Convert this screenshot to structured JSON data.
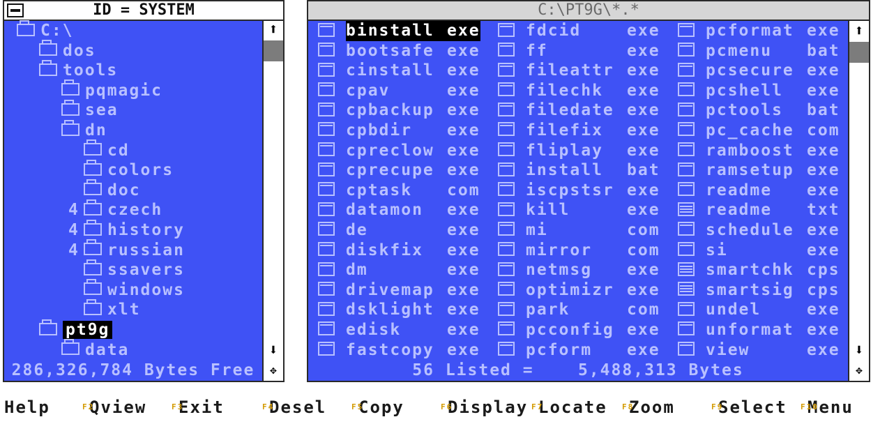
{
  "tree_window": {
    "title": "ID = SYSTEM",
    "footer": "286,326,784 Bytes Free",
    "nodes": [
      {
        "label": "C:\\",
        "depth": 0,
        "prefix": ""
      },
      {
        "label": "dos",
        "depth": 1,
        "prefix": ""
      },
      {
        "label": "tools",
        "depth": 1,
        "prefix": ""
      },
      {
        "label": "pqmagic",
        "depth": 2,
        "prefix": ""
      },
      {
        "label": "sea",
        "depth": 2,
        "prefix": ""
      },
      {
        "label": "dn",
        "depth": 2,
        "prefix": ""
      },
      {
        "label": "cd",
        "depth": 3,
        "prefix": ""
      },
      {
        "label": "colors",
        "depth": 3,
        "prefix": ""
      },
      {
        "label": "doc",
        "depth": 3,
        "prefix": ""
      },
      {
        "label": "czech",
        "depth": 3,
        "prefix": "4"
      },
      {
        "label": "history",
        "depth": 3,
        "prefix": "4"
      },
      {
        "label": "russian",
        "depth": 3,
        "prefix": "4"
      },
      {
        "label": "ssavers",
        "depth": 3,
        "prefix": ""
      },
      {
        "label": "windows",
        "depth": 3,
        "prefix": ""
      },
      {
        "label": "xlt",
        "depth": 3,
        "prefix": ""
      },
      {
        "label": "pt9g",
        "depth": 1,
        "prefix": "",
        "selected": true
      },
      {
        "label": "data",
        "depth": 2,
        "prefix": ""
      }
    ]
  },
  "files_window": {
    "title": "C:\\PT9G\\*.*",
    "footer": "56 Listed =    5,488,313 Bytes",
    "columns": [
      [
        {
          "name": "binstall",
          "ext": "exe",
          "highlight": true
        },
        {
          "name": "bootsafe",
          "ext": "exe"
        },
        {
          "name": "cinstall",
          "ext": "exe"
        },
        {
          "name": "cpav",
          "ext": "exe"
        },
        {
          "name": "cpbackup",
          "ext": "exe"
        },
        {
          "name": "cpbdir",
          "ext": "exe"
        },
        {
          "name": "cpreclow",
          "ext": "exe"
        },
        {
          "name": "cprecupe",
          "ext": "exe"
        },
        {
          "name": "cptask",
          "ext": "com"
        },
        {
          "name": "datamon",
          "ext": "exe"
        },
        {
          "name": "de",
          "ext": "exe"
        },
        {
          "name": "diskfix",
          "ext": "exe"
        },
        {
          "name": "dm",
          "ext": "exe"
        },
        {
          "name": "drivemap",
          "ext": "exe"
        },
        {
          "name": "dsklight",
          "ext": "exe"
        },
        {
          "name": "edisk",
          "ext": "exe"
        },
        {
          "name": "fastcopy",
          "ext": "exe"
        }
      ],
      [
        {
          "name": "fdcid",
          "ext": "exe"
        },
        {
          "name": "ff",
          "ext": "exe"
        },
        {
          "name": "fileattr",
          "ext": "exe"
        },
        {
          "name": "filechk",
          "ext": "exe"
        },
        {
          "name": "filedate",
          "ext": "exe"
        },
        {
          "name": "filefix",
          "ext": "exe"
        },
        {
          "name": "fliplay",
          "ext": "exe"
        },
        {
          "name": "install",
          "ext": "bat"
        },
        {
          "name": "iscpstsr",
          "ext": "exe"
        },
        {
          "name": "kill",
          "ext": "exe"
        },
        {
          "name": "mi",
          "ext": "com"
        },
        {
          "name": "mirror",
          "ext": "com"
        },
        {
          "name": "netmsg",
          "ext": "exe"
        },
        {
          "name": "optimizr",
          "ext": "exe"
        },
        {
          "name": "park",
          "ext": "com"
        },
        {
          "name": "pcconfig",
          "ext": "exe"
        },
        {
          "name": "pcform",
          "ext": "exe"
        }
      ],
      [
        {
          "name": "pcformat",
          "ext": "exe"
        },
        {
          "name": "pcmenu",
          "ext": "bat"
        },
        {
          "name": "pcsecure",
          "ext": "exe"
        },
        {
          "name": "pcshell",
          "ext": "exe"
        },
        {
          "name": "pctools",
          "ext": "bat"
        },
        {
          "name": "pc_cache",
          "ext": "com"
        },
        {
          "name": "ramboost",
          "ext": "exe"
        },
        {
          "name": "ramsetup",
          "ext": "exe"
        },
        {
          "name": "readme",
          "ext": "exe"
        },
        {
          "name": "readme",
          "ext": "txt",
          "doc": true
        },
        {
          "name": "schedule",
          "ext": "exe"
        },
        {
          "name": "si",
          "ext": "exe"
        },
        {
          "name": "smartchk",
          "ext": "cps",
          "doc": true
        },
        {
          "name": "smartsig",
          "ext": "cps",
          "doc": true
        },
        {
          "name": "undel",
          "ext": "exe"
        },
        {
          "name": "unformat",
          "ext": "exe"
        },
        {
          "name": "view",
          "ext": "exe"
        }
      ]
    ]
  },
  "menu": [
    {
      "key": "",
      "label": "Help"
    },
    {
      "key": "F2",
      "label": "Qview"
    },
    {
      "key": "F3",
      "label": "Exit"
    },
    {
      "key": "F4",
      "label": "Desel"
    },
    {
      "key": "F5",
      "label": "Copy"
    },
    {
      "key": "F6",
      "label": "Display"
    },
    {
      "key": "F7",
      "label": "Locate"
    },
    {
      "key": "F8",
      "label": "Zoom"
    },
    {
      "key": "F9",
      "label": "Select"
    },
    {
      "key": "F10",
      "label": "Menu"
    }
  ],
  "colors": {
    "panel": "#3f52f5",
    "text": "#b8c0ff",
    "accent": "#d49a00"
  }
}
